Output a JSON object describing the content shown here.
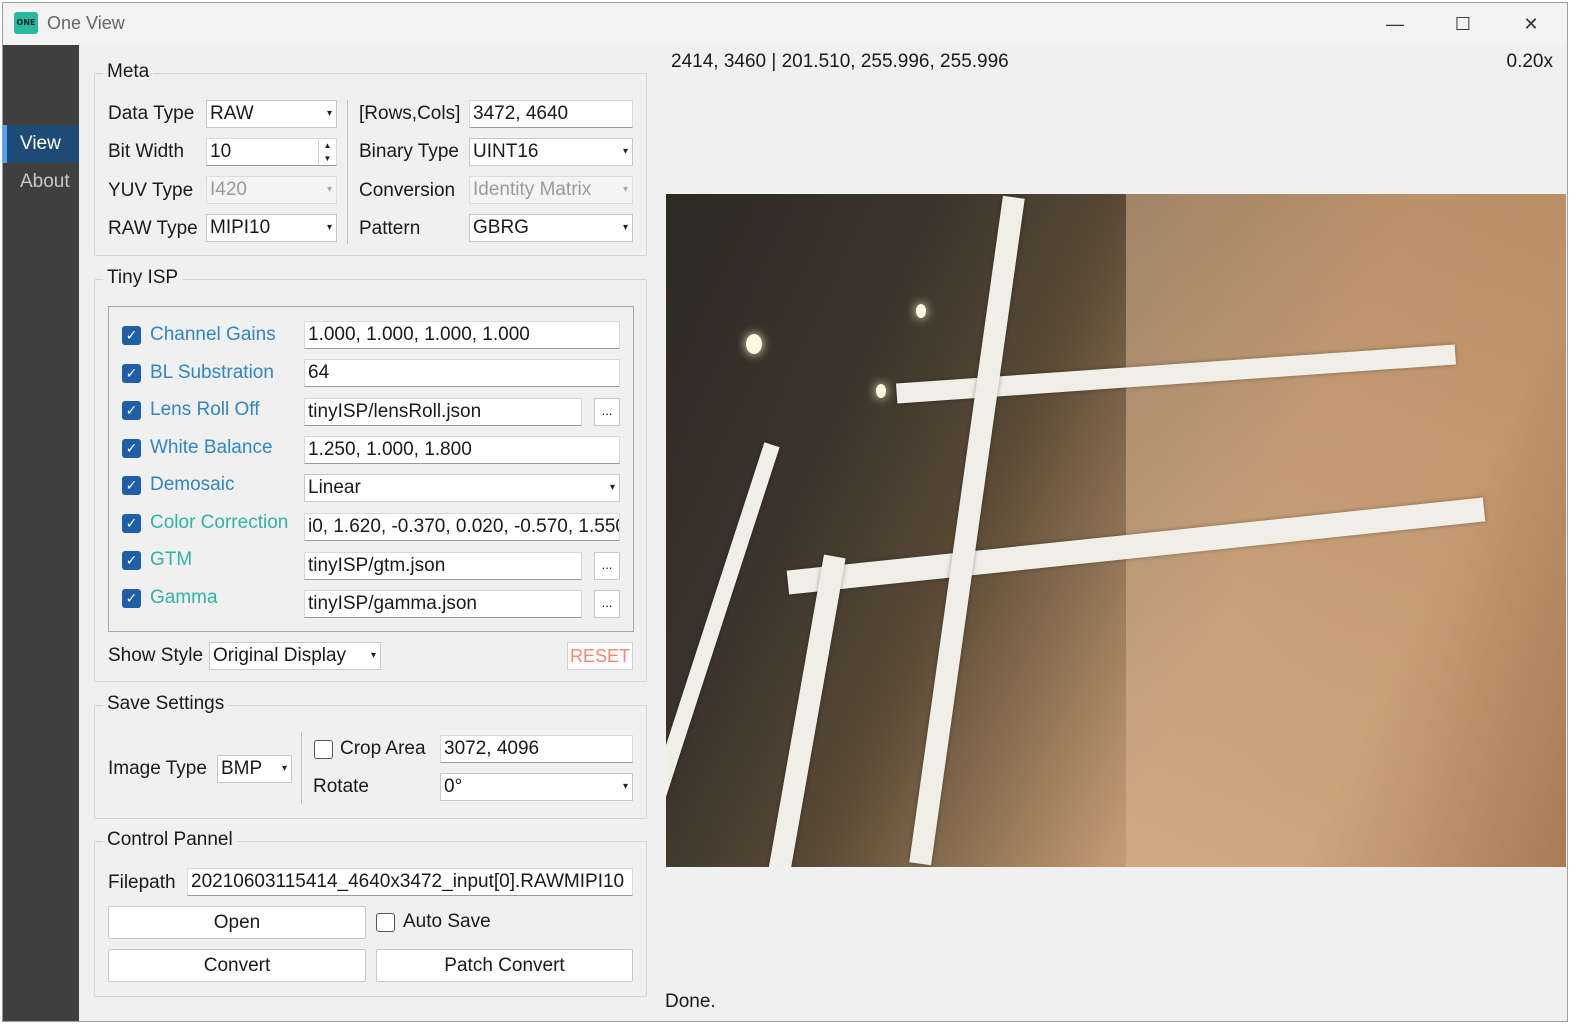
{
  "window": {
    "title": "One View",
    "icon_text": "ONE",
    "controls": {
      "minimize": "—",
      "maximize": "☐",
      "close": "✕"
    }
  },
  "sidebar": {
    "items": [
      {
        "label": "View",
        "active": true
      },
      {
        "label": "About",
        "active": false
      }
    ]
  },
  "meta": {
    "title": "Meta",
    "data_type_label": "Data Type",
    "data_type": "RAW",
    "bit_width_label": "Bit Width",
    "bit_width": "10",
    "yuv_type_label": "YUV Type",
    "yuv_type": "I420",
    "raw_type_label": "RAW Type",
    "raw_type": "MIPI10",
    "rows_cols_label": "[Rows,Cols]",
    "rows_cols": "3472, 4640",
    "binary_type_label": "Binary Type",
    "binary_type": "UINT16",
    "conversion_label": "Conversion",
    "conversion": "Identity Matrix",
    "pattern_label": "Pattern",
    "pattern": "GBRG"
  },
  "tiny_isp": {
    "title": "Tiny ISP",
    "items": [
      {
        "label": "Channel Gains",
        "value": "1.000, 1.000, 1.000, 1.000",
        "checked": true
      },
      {
        "label": "BL Substration",
        "value": "64",
        "checked": true
      },
      {
        "label": "Lens Roll Off",
        "value": "tinyISP/lensRoll.json",
        "checked": true,
        "browse": "..."
      },
      {
        "label": "White Balance",
        "value": "1.250, 1.000, 1.800",
        "checked": true
      },
      {
        "label": "Demosaic",
        "value": "Linear",
        "checked": true
      },
      {
        "label": "Color Correction",
        "value": "i0, 1.620, -0.370, 0.020, -0.570, 1.550",
        "checked": true
      },
      {
        "label": "GTM",
        "value": "tinyISP/gtm.json",
        "checked": true,
        "browse": "..."
      },
      {
        "label": "Gamma",
        "value": "tinyISP/gamma.json",
        "checked": true,
        "browse": "..."
      }
    ],
    "show_style_label": "Show Style",
    "show_style": "Original Display",
    "reset_label": "RESET"
  },
  "save_settings": {
    "title": "Save Settings",
    "image_type_label": "Image Type",
    "image_type": "BMP",
    "crop_area_label": "Crop Area",
    "crop_area_checked": false,
    "crop_area": "3072, 4096",
    "rotate_label": "Rotate",
    "rotate": "0°"
  },
  "control_panel": {
    "title": "Control Pannel",
    "filepath_label": "Filepath",
    "filepath": "20210603115414_4640x3472_input[0].RAWMIPI10",
    "open_label": "Open",
    "auto_save_label": "Auto Save",
    "auto_save_checked": false,
    "convert_label": "Convert",
    "patch_convert_label": "Patch Convert"
  },
  "viewer": {
    "coords": "2414, 3460 | 201.510, 255.996, 255.996",
    "zoom": "0.20x",
    "status": "Done."
  },
  "icons": {
    "check": "✓",
    "combo_arrow": "▾",
    "spin_up": "▲",
    "spin_down": "▼"
  }
}
